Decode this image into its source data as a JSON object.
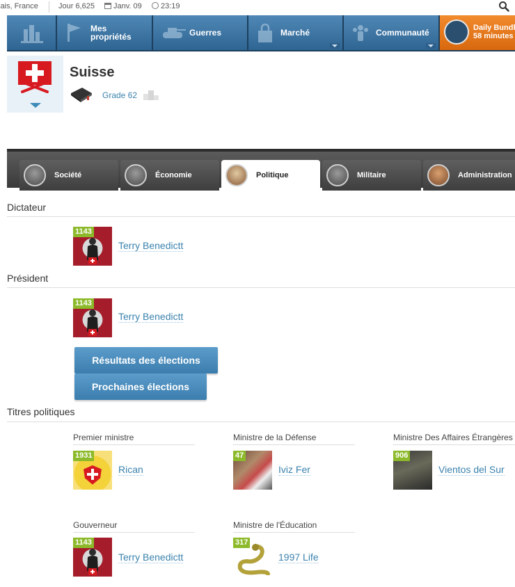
{
  "status": {
    "location": "lais, France",
    "day": "Jour 6,625",
    "date": "Janv. 09",
    "time": "23:19"
  },
  "nav": {
    "items": [
      {
        "label": "Mes propriétés",
        "icon": "city-icon"
      },
      {
        "label": "Guerres",
        "icon": "tank-icon"
      },
      {
        "label": "Marché",
        "icon": "bag-icon"
      },
      {
        "label": "Communauté",
        "icon": "people-icon"
      }
    ],
    "daily_bundle": {
      "label": "Daily Bundle",
      "timer": "58 minutes"
    }
  },
  "country": {
    "name": "Suisse",
    "grade": "Grade 62",
    "flag_color": "#d71920"
  },
  "tabs": [
    {
      "label": "Société",
      "active": false
    },
    {
      "label": "Économie",
      "active": false
    },
    {
      "label": "Politique",
      "active": true
    },
    {
      "label": "Militaire",
      "active": false
    },
    {
      "label": "Administration",
      "active": false
    }
  ],
  "sections": {
    "dictator": {
      "title": "Dictateur",
      "person": {
        "level": "1143",
        "name": "Terry Benedictt"
      }
    },
    "president": {
      "title": "Président",
      "person": {
        "level": "1143",
        "name": "Terry Benedictt"
      }
    },
    "buttons": {
      "results": "Résultats des élections",
      "next": "Prochaines élections"
    },
    "titles": {
      "title": "Titres politiques",
      "roles": [
        {
          "role": "Premier ministre",
          "level": "1931",
          "name": "Rican"
        },
        {
          "role": "Ministre de la Défense",
          "level": "47",
          "name": "Iviz Fer"
        },
        {
          "role": "Ministre Des Affaires Étrangères",
          "level": "906",
          "name": "Vientos del Sur"
        },
        {
          "role": "Gouverneur",
          "level": "1143",
          "name": "Terry Benedictt"
        },
        {
          "role": "Ministre de l'Éducation",
          "level": "317",
          "name": "1997 Life"
        }
      ]
    }
  },
  "colors": {
    "nav_blue": "#3f77a6",
    "orange": "#e57a1f",
    "link": "#3a82ad",
    "level_green": "#8cba2a"
  }
}
